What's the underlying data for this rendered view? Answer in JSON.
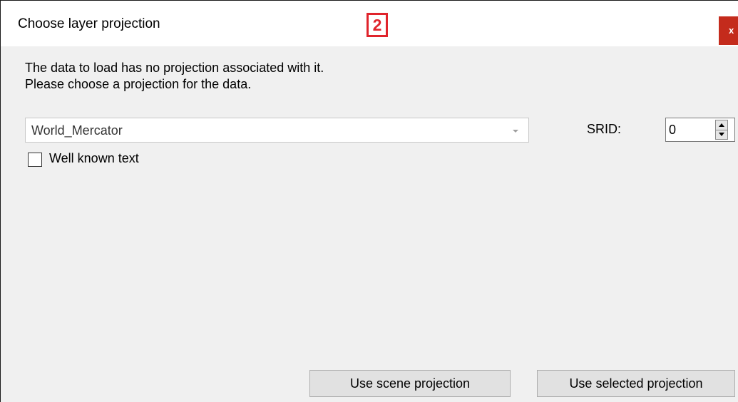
{
  "window": {
    "title": "Choose layer projection",
    "step_badge": "2",
    "close_label": "x"
  },
  "message": {
    "line1": "The data to load has no projection associated with it.",
    "line2": "Please choose a projection for the data."
  },
  "projection_select": {
    "value": "World_Mercator"
  },
  "srid": {
    "label": "SRID:",
    "value": "0"
  },
  "well_known_text": {
    "label": "Well known text",
    "checked": false
  },
  "buttons": {
    "use_scene": "Use scene projection",
    "use_selected": "Use selected projection"
  },
  "colors": {
    "badge": "#e0242c",
    "close": "#c42b1c",
    "dialog_bg": "#f0f0f0"
  }
}
